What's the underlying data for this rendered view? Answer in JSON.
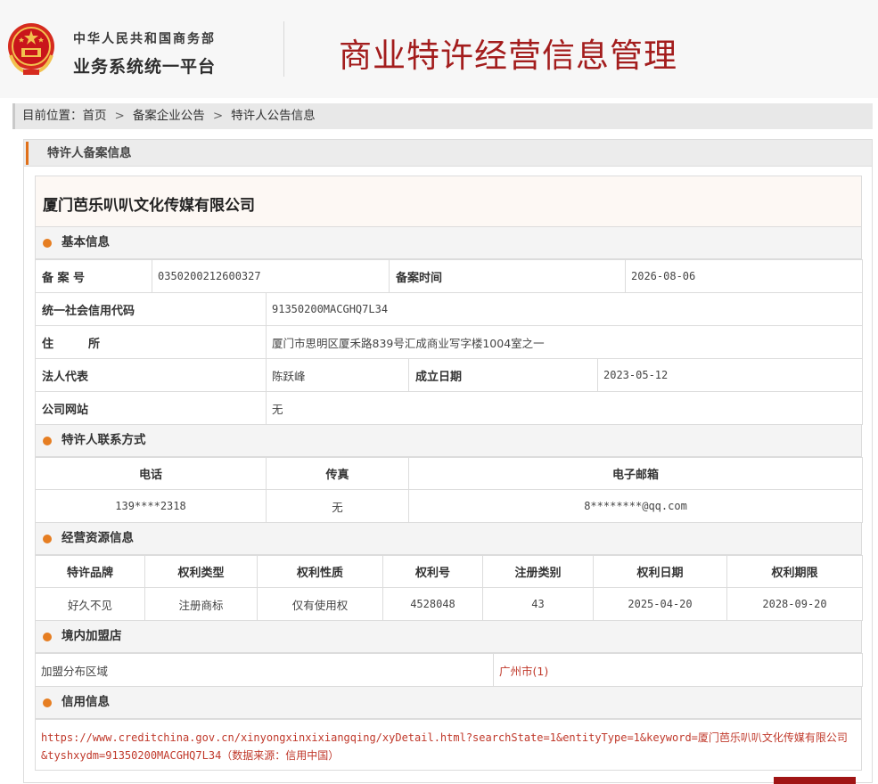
{
  "header": {
    "ministry": "中华人民共和国商务部",
    "platform": "业务系统统一平台",
    "title": "商业特许经营信息管理"
  },
  "breadcrumb": {
    "prefix": "目前位置：",
    "items": [
      "首页",
      "备案企业公告",
      "特许人公告信息"
    ],
    "separator": ">"
  },
  "panel": {
    "title": "特许人备案信息"
  },
  "company": {
    "name": "厦门芭乐叭叭文化传媒有限公司"
  },
  "basic": {
    "section_title": "基本信息",
    "record_no_label": "备 案 号",
    "record_no": "0350200212600327",
    "record_time_label": "备案时间",
    "record_time": "2026-08-06",
    "credit_code_label": "统一社会信用代码",
    "credit_code": "91350200MACGHQ7L34",
    "address_label": "住　　　所",
    "address": "厦门市思明区厦禾路839号汇成商业写字楼1004室之一",
    "legal_rep_label": "法人代表",
    "legal_rep": "陈跃峰",
    "founded_label": "成立日期",
    "founded": "2023-05-12",
    "website_label": "公司网站",
    "website": "无"
  },
  "contact": {
    "section_title": "特许人联系方式",
    "headers": [
      "电话",
      "传真",
      "电子邮箱"
    ],
    "values": [
      "139****2318",
      "无",
      "8********@qq.com"
    ]
  },
  "resources": {
    "section_title": "经营资源信息",
    "headers": [
      "特许品牌",
      "权利类型",
      "权利性质",
      "权利号",
      "注册类别",
      "权利日期",
      "权利期限"
    ],
    "row": [
      "好久不见",
      "注册商标",
      "仅有使用权",
      "4528048",
      "43",
      "2025-04-20",
      "2028-09-20"
    ]
  },
  "stores": {
    "section_title": "境内加盟店",
    "area_label": "加盟分布区域",
    "area_value": "广州市(1)"
  },
  "credit": {
    "section_title": "信用信息",
    "link_line1": "https://www.creditchina.gov.cn/xinyongxinxixiangqing/xyDetail.html?searchState=1&entityType=1&keyword=厦门芭乐叭叭文化传媒有限公司",
    "link_line2": "&tyshxydm=91350200MACGHQ7L34（数据来源：信用中国）"
  },
  "colors": {
    "title_red": "#a31d1d",
    "accent_orange": "#e67e22",
    "link_red": "#c0392b"
  }
}
